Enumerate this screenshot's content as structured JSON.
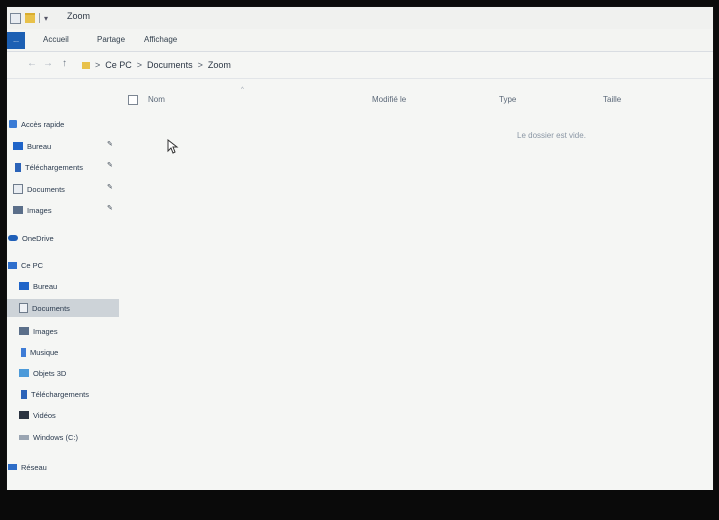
{
  "window": {
    "title": "Zoom"
  },
  "ribbon": {
    "file_tab": "...",
    "tabs": [
      "Accueil",
      "Partage",
      "Affichage"
    ]
  },
  "address": {
    "path": [
      "Ce PC",
      "Documents",
      "Zoom"
    ],
    "separator": ">"
  },
  "columns": {
    "name": "Nom",
    "modified": "Modifié le",
    "type": "Type",
    "size": "Taille"
  },
  "content": {
    "empty_message": "Le dossier est vide."
  },
  "sidebar": {
    "quick_access": "Accès rapide",
    "quick_items": [
      "Bureau",
      "Téléchargements",
      "Documents",
      "Images"
    ],
    "onedrive": "OneDrive",
    "this_pc": "Ce PC",
    "pc_items": [
      "Bureau",
      "Documents",
      "Images",
      "Musique",
      "Objets 3D",
      "Téléchargements",
      "Vidéos",
      "Windows (C:)"
    ],
    "network": "Réseau",
    "selected": "Documents"
  },
  "colors": {
    "accent": "#1c5fb3",
    "folder": "#e8c14a",
    "selection": "#cdd3d8"
  },
  "icons": [
    "folder-icon",
    "back-icon",
    "forward-icon",
    "up-icon",
    "pin-icon",
    "cursor-icon"
  ]
}
